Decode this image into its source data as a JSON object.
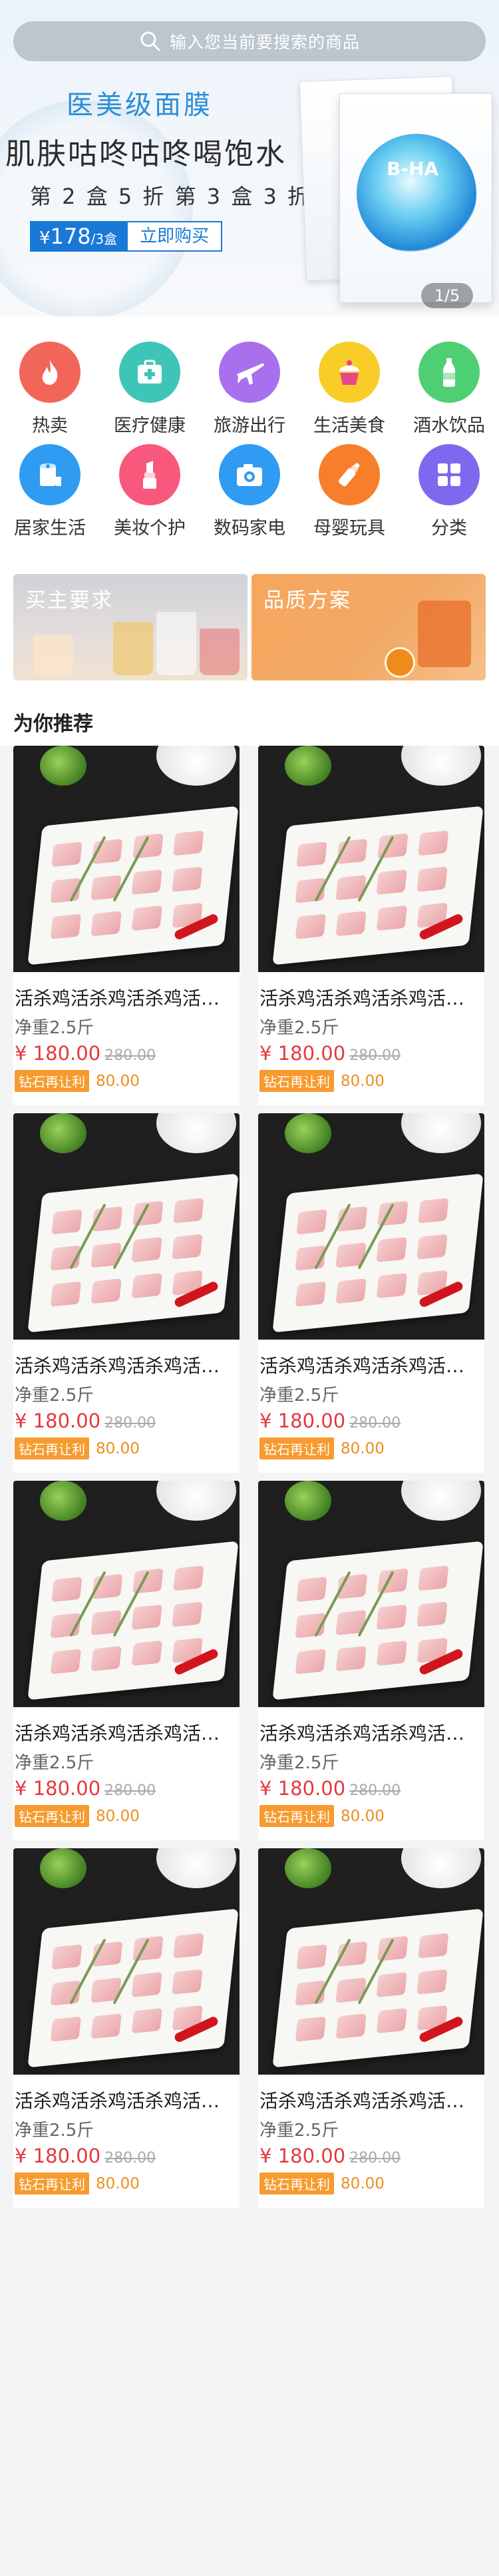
{
  "search": {
    "placeholder": "输入您当前要搜索的商品"
  },
  "banner": {
    "title": "医美级面膜",
    "headline": "肌肤咕咚咕咚喝饱水",
    "offer": "第 2 盒 5 折   第 3 盒 3 折",
    "price_currency": "¥",
    "price_value": "178",
    "price_unit": "/3盒",
    "buy_label": "立即购买",
    "product_brand": "B-HA",
    "counter": "1/5"
  },
  "categories": [
    {
      "label": "热卖",
      "icon": "fire-icon",
      "color": "#f26659"
    },
    {
      "label": "医疗健康",
      "icon": "medical-kit-icon",
      "color": "#3fc5b7"
    },
    {
      "label": "旅游出行",
      "icon": "airplane-icon",
      "color": "#a970ed"
    },
    {
      "label": "生活美食",
      "icon": "cupcake-icon",
      "color": "#f9cd27"
    },
    {
      "label": "酒水饮品",
      "icon": "bottle-icon",
      "color": "#4fcf74"
    },
    {
      "label": "居家生活",
      "icon": "tissue-icon",
      "color": "#2e9cf2"
    },
    {
      "label": "美妆个护",
      "icon": "lipstick-icon",
      "color": "#f7587c"
    },
    {
      "label": "数码家电",
      "icon": "camera-icon",
      "color": "#2f9bf2"
    },
    {
      "label": "母婴玩具",
      "icon": "baby-bottle-icon",
      "color": "#f77e2a"
    },
    {
      "label": "分类",
      "icon": "grid-icon",
      "color": "#8068ee"
    }
  ],
  "promos": [
    {
      "title": "买主要求"
    },
    {
      "title": "品质方案"
    }
  ],
  "recommend": {
    "title": "为你推荐",
    "products": [
      {
        "name": "活杀鸡活杀鸡活杀鸡活杀鸡活杀鸡",
        "spec": "净重2.5斤",
        "price": "¥ 180.00",
        "orig": "280.00",
        "vip_tag": "钻石再让利",
        "vip_price": "80.00"
      },
      {
        "name": "活杀鸡活杀鸡活杀鸡活杀鸡活杀鸡",
        "spec": "净重2.5斤",
        "price": "¥ 180.00",
        "orig": "280.00",
        "vip_tag": "钻石再让利",
        "vip_price": "80.00"
      },
      {
        "name": "活杀鸡活杀鸡活杀鸡活杀鸡活杀鸡",
        "spec": "净重2.5斤",
        "price": "¥ 180.00",
        "orig": "280.00",
        "vip_tag": "钻石再让利",
        "vip_price": "80.00"
      },
      {
        "name": "活杀鸡活杀鸡活杀鸡活杀鸡活杀鸡",
        "spec": "净重2.5斤",
        "price": "¥ 180.00",
        "orig": "280.00",
        "vip_tag": "钻石再让利",
        "vip_price": "80.00"
      },
      {
        "name": "活杀鸡活杀鸡活杀鸡活杀鸡活杀鸡",
        "spec": "净重2.5斤",
        "price": "¥ 180.00",
        "orig": "280.00",
        "vip_tag": "钻石再让利",
        "vip_price": "80.00"
      },
      {
        "name": "活杀鸡活杀鸡活杀鸡活杀鸡活杀鸡",
        "spec": "净重2.5斤",
        "price": "¥ 180.00",
        "orig": "280.00",
        "vip_tag": "钻石再让利",
        "vip_price": "80.00"
      },
      {
        "name": "活杀鸡活杀鸡活杀鸡活杀鸡活杀鸡",
        "spec": "净重2.5斤",
        "price": "¥ 180.00",
        "orig": "280.00",
        "vip_tag": "钻石再让利",
        "vip_price": "80.00"
      },
      {
        "name": "活杀鸡活杀鸡活杀鸡活杀鸡活杀鸡",
        "spec": "净重2.5斤",
        "price": "¥ 180.00",
        "orig": "280.00",
        "vip_tag": "钻石再让利",
        "vip_price": "80.00"
      }
    ]
  },
  "colors": {
    "accent": "#1a79d6",
    "price_red": "#e4393c",
    "vip_orange": "#f79a2f"
  }
}
